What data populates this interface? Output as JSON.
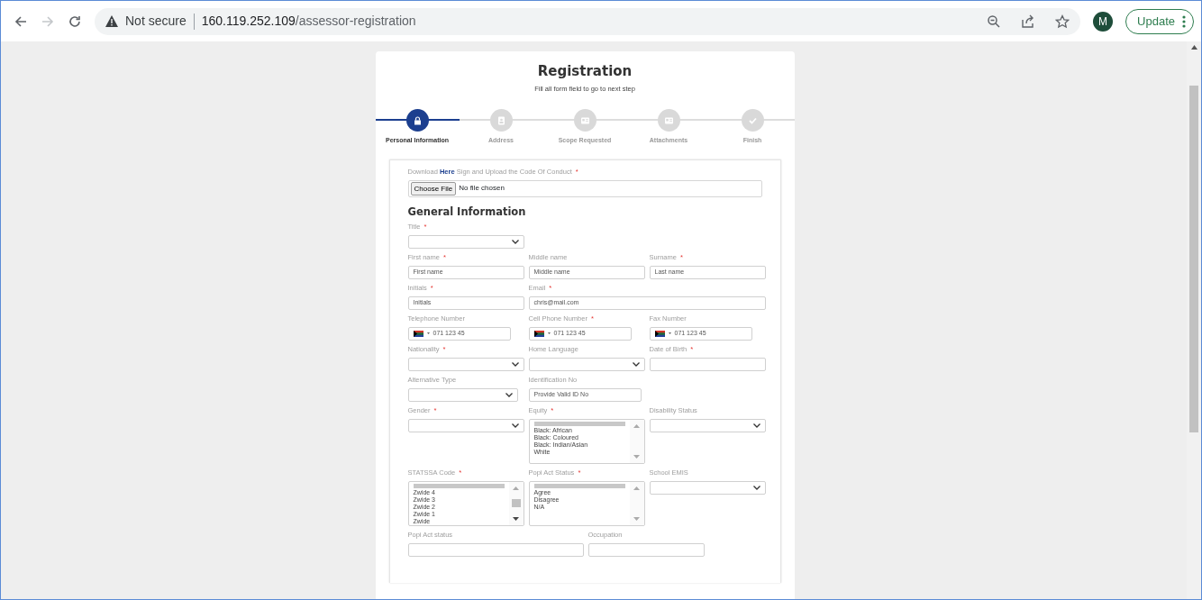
{
  "browser": {
    "security": "Not secure",
    "url_host": "160.119.252.109",
    "url_path": "/assessor-registration",
    "forward_disabled": true,
    "profile_initial": "M",
    "update_label": "Update"
  },
  "page": {
    "title": "Registration",
    "subtitle": "Fill all form field to go to next step",
    "steps": [
      {
        "label": "Personal Information",
        "selected": true
      },
      {
        "label": "Address",
        "selected": false
      },
      {
        "label": "Scope Requested",
        "selected": false
      },
      {
        "label": "Attachments",
        "selected": false
      },
      {
        "label": "Finish",
        "selected": false
      }
    ],
    "download": {
      "before": "Download",
      "link": "Here",
      "after": "Sign and Upload the Code Of Conduct",
      "required_mark": "*"
    },
    "file_input": {
      "button": "Choose File",
      "status": "No file chosen"
    },
    "section_title": "General Information",
    "rows": [
      [
        {
          "label": "Title",
          "required_mark": "*",
          "kind": "select"
        }
      ],
      [
        {
          "label": "First name",
          "required_mark": "*",
          "kind": "text",
          "placeholder": "First name"
        },
        {
          "label": "Middle name",
          "kind": "text",
          "placeholder": "Middle name"
        },
        {
          "label": "Surname",
          "required_mark": "*",
          "kind": "text",
          "placeholder": "Last name"
        }
      ],
      [
        {
          "label": "Initials",
          "required_mark": "*",
          "kind": "text",
          "placeholder": "Initials"
        },
        {
          "label": "Email",
          "required_mark": "*",
          "kind": "wide",
          "placeholder": "chris@mail.com"
        }
      ],
      [
        {
          "label": "Telephone Number",
          "kind": "phone",
          "placeholder": "071 123 45"
        },
        {
          "label": "Cell Phone Number",
          "required_mark": "*",
          "kind": "phone",
          "placeholder": "071 123 45"
        },
        {
          "label": "Fax Number",
          "kind": "phone",
          "placeholder": "071 123 45"
        }
      ],
      [
        {
          "label": "Nationality",
          "required_mark": "*",
          "kind": "select"
        },
        {
          "label": "Home Language",
          "kind": "select"
        },
        {
          "label": "Date of Birth",
          "required_mark": "*",
          "kind": "text"
        }
      ],
      [
        {
          "label": "Alternative Type",
          "kind": "select"
        },
        {
          "label": "Identification No",
          "kind": "text",
          "placeholder": "Provide Valid ID No"
        }
      ],
      [
        {
          "label": "Gender",
          "required_mark": "*",
          "kind": "select"
        },
        {
          "label": "Equity",
          "required_mark": "*",
          "kind": "listbox",
          "blank_selected": true,
          "options": [
            "Black: African",
            "Black: Coloured",
            "Black: Indian/Asian",
            "White"
          ]
        },
        {
          "label": "Disability Status",
          "kind": "select"
        }
      ],
      [
        {
          "label": "STATSSA Code",
          "required_mark": "*",
          "kind": "listbox",
          "blank_selected": true,
          "scrollable": true,
          "options": [
            "Zwide 4",
            "Zwide 3",
            "Zwide 2",
            "Zwide 1",
            "Zwide"
          ]
        },
        {
          "label": "Popi Act Status",
          "required_mark": "*",
          "kind": "listbox",
          "blank_selected": true,
          "options": [
            "Agree",
            "Disagree",
            "N/A"
          ]
        },
        {
          "label": "School EMIS",
          "kind": "select"
        }
      ],
      [
        {
          "label": "Popi Act status",
          "kind": "text"
        },
        {
          "label": "Occupation",
          "kind": "text"
        }
      ]
    ]
  }
}
